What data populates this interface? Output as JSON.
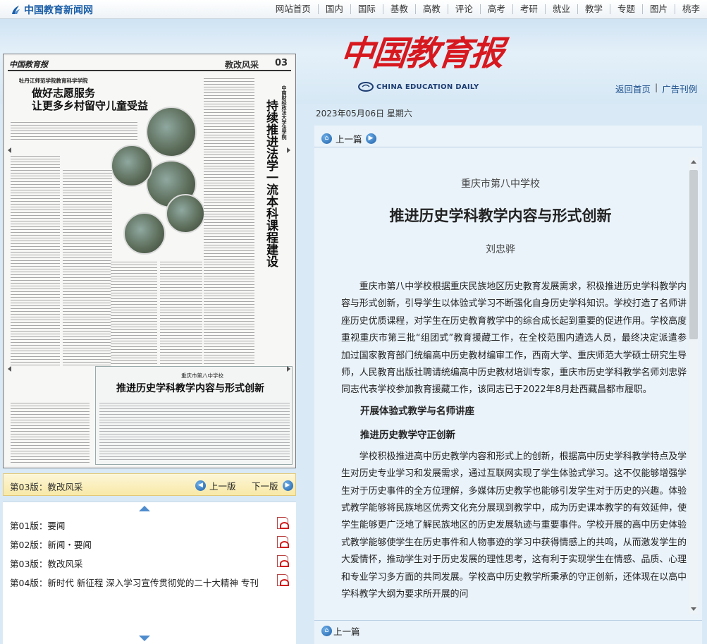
{
  "site": {
    "name": "中国教育新闻网"
  },
  "topnav": [
    "网站首页",
    "国内",
    "国际",
    "基教",
    "高教",
    "评论",
    "高考",
    "考研",
    "就业",
    "教学",
    "专题",
    "图片",
    "桃李"
  ],
  "masthead": {
    "title": "中国教育报",
    "subtitle": "CHINA EDUCATION DAILY",
    "links": {
      "home": "返回首页",
      "ads": "广告刊例"
    }
  },
  "issue": {
    "date": "2023年05月06日",
    "weekday": "星期六"
  },
  "newspaper": {
    "masthead": "中国教育报",
    "section": "教改风采",
    "page_no": "03",
    "article1": {
      "kicker": "牡丹江师范学院教育科学学院",
      "title_line1": "做好志愿服务",
      "title_line2": "让更多乡村留守儿童受益"
    },
    "article2": {
      "kicker": "中南财经政法大学法学院",
      "title": "持续推进法学一流本科课程建设"
    },
    "article3": {
      "kicker": "重庆市第八中学校",
      "title": "推进历史学科教学内容与形式创新"
    }
  },
  "page_bar": {
    "label": "第03版：教改风采",
    "prev": "上一版",
    "next": "下一版"
  },
  "page_list": [
    {
      "label": "第01版：要闻"
    },
    {
      "label": "第02版：新闻・要闻"
    },
    {
      "label": "第03版：教改风采"
    },
    {
      "label": "第04版：新时代 新征程 深入学习宣传贯彻党的二十大精神 专刊"
    }
  ],
  "article_nav": {
    "prev": "上一篇",
    "prev_bottom": "上一篇"
  },
  "article": {
    "kicker": "重庆市第八中学校",
    "title": "推进历史学科教学内容与形式创新",
    "author": "刘忠骅",
    "para1": "重庆市第八中学校根据重庆民族地区历史教育发展需求，积极推进历史学科教学内容与形式创新，引导学生以体验式学习不断强化自身历史学科知识。学校打造了名师讲座历史优质课程，对学生在历史教育教学中的综合成长起到重要的促进作用。学校高度重视重庆市第三批“组团式”教育援藏工作，在全校范围内遴选人员，最终决定派遣参加过国家教育部门统编高中历史教材编审工作，西南大学、重庆师范大学硕士研究生导师，人民教育出版社聘请统编高中历史教材培训专家，重庆市历史学科教学名师刘忠骅同志代表学校参加教育援藏工作，该同志已于2022年8月赴西藏昌都市履职。",
    "sub1": "开展体验式教学与名师讲座",
    "sub2": "推进历史教学守正创新",
    "para2": "学校积极推进高中历史教学内容和形式上的创新，根据高中历史学科教学特点及学生对历史专业学习和发展需求，通过互联网实现了学生体验式学习。这不仅能够增强学生对于历史事件的全方位理解，多媒体历史教学也能够引发学生对于历史的兴趣。体验式教学能够将民族地区优秀文化充分展现到教学中，成为历史课本教学的有效延伸，使学生能够更广泛地了解民族地区的历史发展轨迹与重要事件。学校开展的高中历史体验式教学能够使学生在历史事件和人物事迹的学习中获得情感上的共鸣，从而激发学生的大爱情怀，推动学生对于历史发展的理性思考，这有利于实现学生在情感、品质、心理和专业学习多方面的共同发展。学校高中历史教学所秉承的守正创新，还体现在以高中学科教学大纲为要求所开展的问"
  },
  "colors": {
    "accent": "#1c5fa8",
    "masthead_red": "#d7191f",
    "page_bar": "#f8e9a7"
  }
}
